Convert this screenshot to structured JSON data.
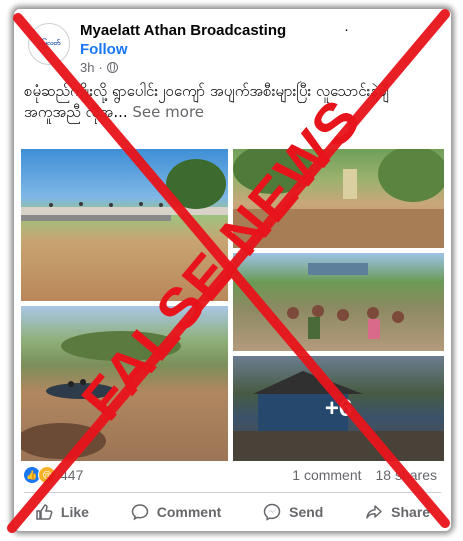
{
  "post": {
    "avatar_text": "မြေလတ်",
    "page_name": "Myaelatt Athan Broadcasting",
    "dot": "·",
    "follow_label": "Follow",
    "time": "3h",
    "meta_sep": "·",
    "text": "စမုံဆည်ကျိုးလို့ ရွာပေါင်း၂၀ကျော် အပျက်အစီးများပြီး လူသောင်းနဲ့ချီ အကူအညီ လိုအ...",
    "see_more": "See more",
    "more_photos": "+6"
  },
  "engagement": {
    "reaction_count": "447",
    "comments": "1 comment",
    "shares": "18 shares"
  },
  "actions": {
    "like": "Like",
    "comment": "Comment",
    "send": "Send",
    "share": "Share"
  },
  "stamp": {
    "text": "FALSE NEWS",
    "color": "#e8141b"
  }
}
